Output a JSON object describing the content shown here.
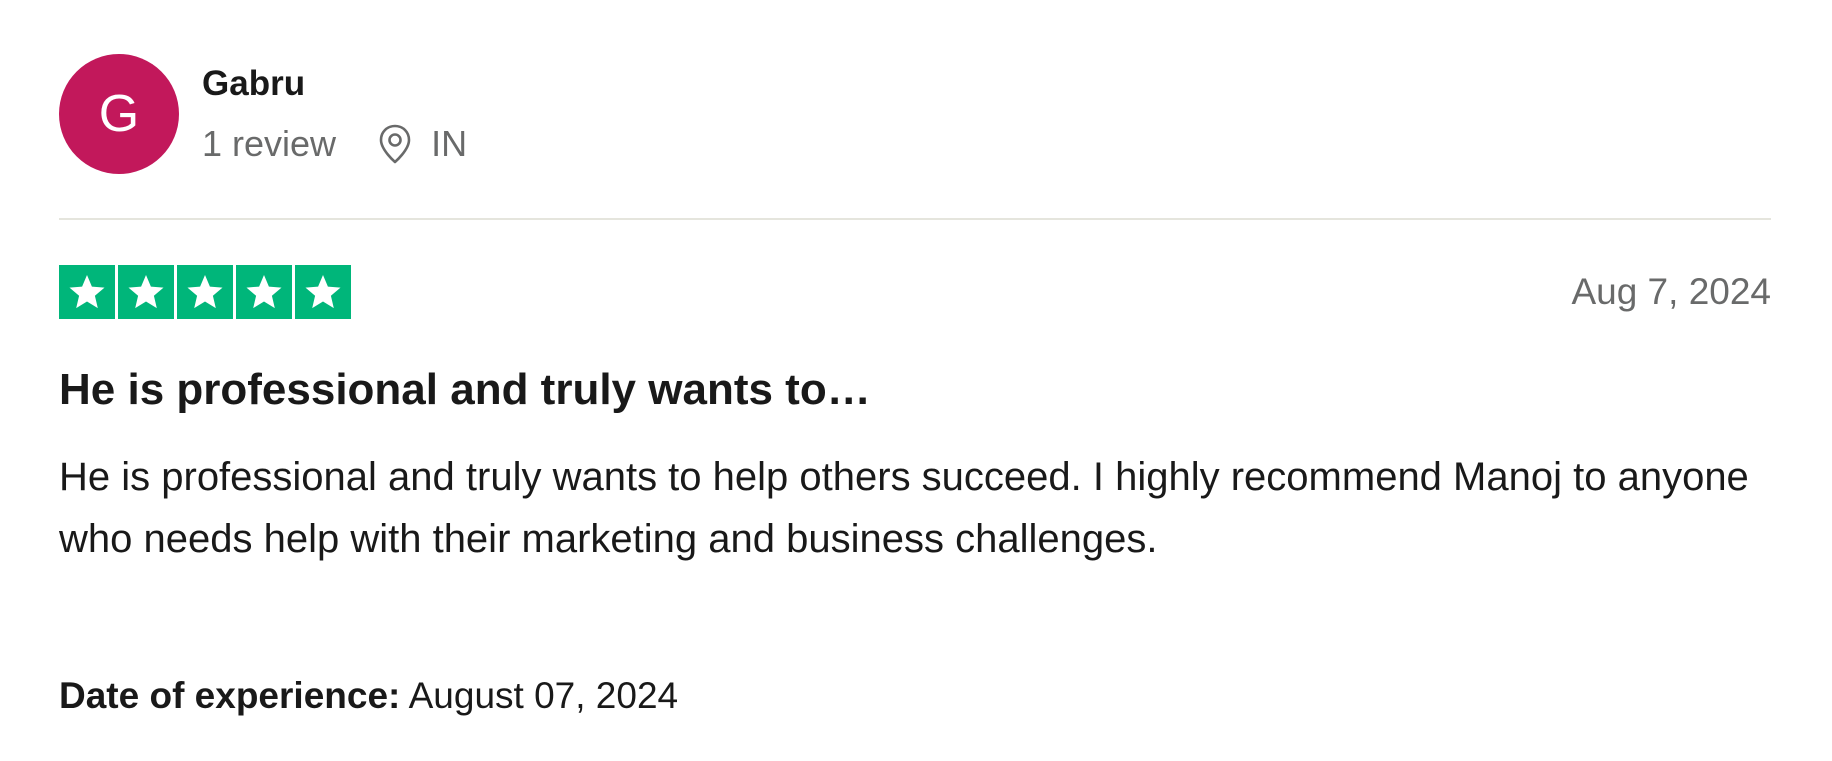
{
  "reviewer": {
    "initial": "G",
    "name": "Gabru",
    "review_count": "1 review",
    "location_icon": "map-pin-icon",
    "country": "IN",
    "avatar_color": "#c2185b"
  },
  "review": {
    "rating": 5,
    "rating_max": 5,
    "star_color": "#00b67a",
    "star_icon": "star-icon",
    "date": "Aug 7, 2024",
    "title": "He is professional and truly wants to…",
    "body": "He is professional and truly wants to help others succeed. I highly recommend Manoj to anyone who needs help with their marketing and business challenges.",
    "experience_label": "Date of experience:",
    "experience_date": "August 07, 2024"
  }
}
